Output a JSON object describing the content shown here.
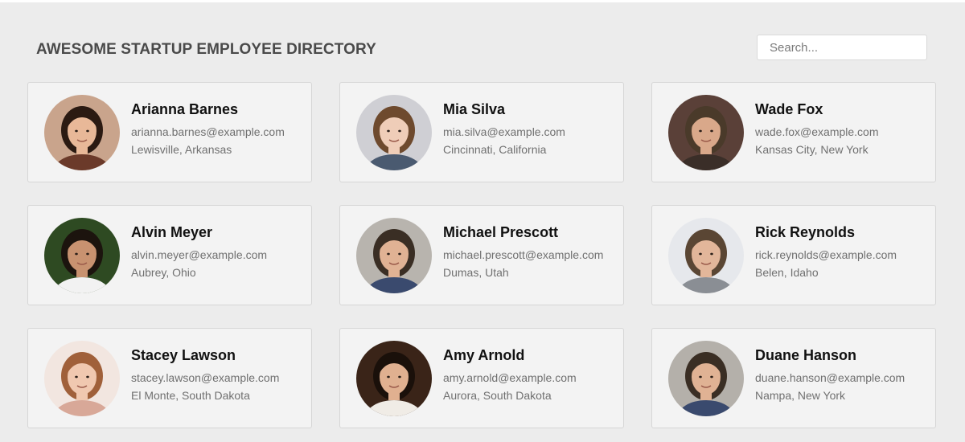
{
  "header": {
    "title": "AWESOME STARTUP EMPLOYEE DIRECTORY",
    "search_placeholder": "Search..."
  },
  "employees": [
    {
      "name": "Arianna Barnes",
      "email": "arianna.barnes@example.com",
      "location": "Lewisville, Arkansas",
      "avatar_colors": {
        "bg": "#c9a48c",
        "hair": "#2b1a12",
        "skin": "#e8b898",
        "shirt": "#6b3a2a"
      }
    },
    {
      "name": "Mia Silva",
      "email": "mia.silva@example.com",
      "location": "Cincinnati, California",
      "avatar_colors": {
        "bg": "#cfcfd4",
        "hair": "#6e4a2e",
        "skin": "#efcdb8",
        "shirt": "#4a5a70"
      }
    },
    {
      "name": "Wade Fox",
      "email": "wade.fox@example.com",
      "location": "Kansas City, New York",
      "avatar_colors": {
        "bg": "#5a4038",
        "hair": "#4a3a2a",
        "skin": "#d9a88a",
        "shirt": "#3a2e28"
      }
    },
    {
      "name": "Alvin Meyer",
      "email": "alvin.meyer@example.com",
      "location": "Aubrey, Ohio",
      "avatar_colors": {
        "bg": "#2e4a22",
        "hair": "#1c140e",
        "skin": "#c89270",
        "shirt": "#f2f2f2"
      }
    },
    {
      "name": "Michael Prescott",
      "email": "michael.prescott@example.com",
      "location": "Dumas, Utah",
      "avatar_colors": {
        "bg": "#b8b4ae",
        "hair": "#3a2e24",
        "skin": "#e0b294",
        "shirt": "#3a4a6e"
      }
    },
    {
      "name": "Rick Reynolds",
      "email": "rick.reynolds@example.com",
      "location": "Belen, Idaho",
      "avatar_colors": {
        "bg": "#e6e8ec",
        "hair": "#5a4634",
        "skin": "#e2b69a",
        "shirt": "#8a8e94"
      }
    },
    {
      "name": "Stacey Lawson",
      "email": "stacey.lawson@example.com",
      "location": "El Monte, South Dakota",
      "avatar_colors": {
        "bg": "#f2e6e0",
        "hair": "#a0603a",
        "skin": "#f0c8b0",
        "shirt": "#d8a898"
      }
    },
    {
      "name": "Amy Arnold",
      "email": "amy.arnold@example.com",
      "location": "Aurora, South Dakota",
      "avatar_colors": {
        "bg": "#3a2418",
        "hair": "#1a100a",
        "skin": "#e0b090",
        "shirt": "#f0ece6"
      }
    },
    {
      "name": "Duane Hanson",
      "email": "duane.hanson@example.com",
      "location": "Nampa, New York",
      "avatar_colors": {
        "bg": "#b4b0aa",
        "hair": "#3a2e24",
        "skin": "#e0b294",
        "shirt": "#3a4a6e"
      }
    }
  ]
}
